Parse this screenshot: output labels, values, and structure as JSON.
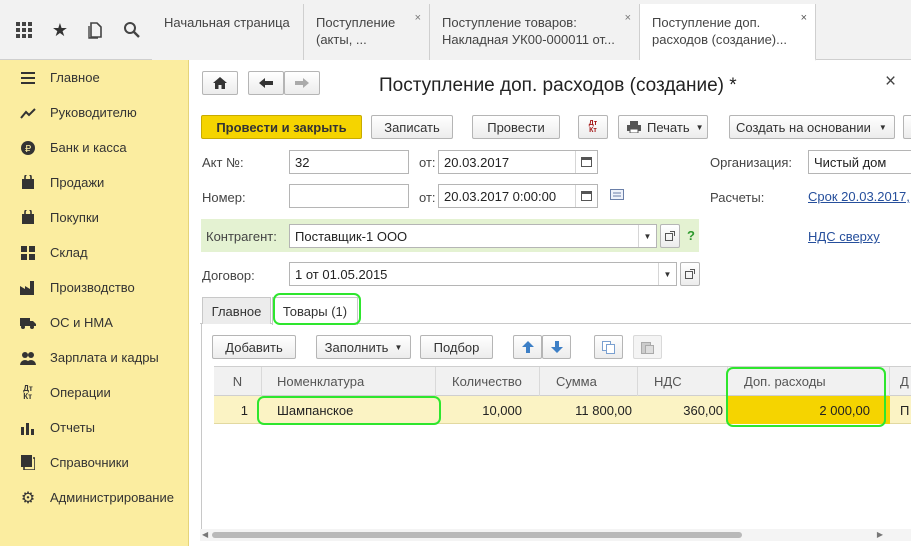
{
  "topbar": {
    "icons": [
      "apps-grid-icon",
      "star-icon",
      "history-icon",
      "search-icon"
    ],
    "tabs": [
      {
        "label": "Начальная страница"
      },
      {
        "label": "Поступление (акты, ..."
      },
      {
        "label": "Поступление товаров: Накладная УК00-000011 от..."
      },
      {
        "label": "Поступление доп. расходов (создание)..."
      }
    ],
    "close_glyph": "×"
  },
  "sidebar": {
    "items": [
      {
        "label": "Главное",
        "icon": "menu-icon"
      },
      {
        "label": "Руководителю",
        "icon": "trend-icon"
      },
      {
        "label": "Банк и касса",
        "icon": "ruble-icon"
      },
      {
        "label": "Продажи",
        "icon": "bag-icon"
      },
      {
        "label": "Покупки",
        "icon": "cart-icon"
      },
      {
        "label": "Склад",
        "icon": "warehouse-icon"
      },
      {
        "label": "Производство",
        "icon": "factory-icon"
      },
      {
        "label": "ОС и НМА",
        "icon": "truck-icon"
      },
      {
        "label": "Зарплата и кадры",
        "icon": "people-icon"
      },
      {
        "label": "Операции",
        "icon": "dt-kt-icon"
      },
      {
        "label": "Отчеты",
        "icon": "bar-chart-icon"
      },
      {
        "label": "Справочники",
        "icon": "book-icon"
      },
      {
        "label": "Администрирование",
        "icon": "gear-icon"
      }
    ]
  },
  "header": {
    "title": "Поступление доп. расходов (создание) *",
    "close": "×"
  },
  "toolbar": {
    "post_close": "Провести и закрыть",
    "save": "Записать",
    "post": "Провести",
    "dtkt": "Дт Кт",
    "print": "Печать",
    "create_based": "Создать на основании"
  },
  "form": {
    "act_label": "Акт №:",
    "act_value": "32",
    "from_label": "от:",
    "act_date": "20.03.2017",
    "number_label": "Номер:",
    "number_value": "",
    "number_date": "20.03.2017  0:00:00",
    "org_label": "Организация:",
    "org_value": "Чистый дом",
    "calc_label": "Расчеты:",
    "calc_link": "Срок 20.03.2017,",
    "vat_link": "НДС сверху",
    "counterparty_label": "Контрагент:",
    "counterparty_value": "Поставщик-1 ООО",
    "help": "?",
    "contract_label": "Договор:",
    "contract_value": "1 от 01.05.2015"
  },
  "tabs": [
    {
      "label": "Главное"
    },
    {
      "label": "Товары (1)"
    }
  ],
  "table_toolbar": {
    "add": "Добавить",
    "fill": "Заполнить",
    "select": "Подбор"
  },
  "table": {
    "columns": [
      "N",
      "Номенклатура",
      "Количество",
      "Сумма",
      "НДС",
      "Доп. расходы",
      "Д"
    ],
    "rows": [
      {
        "n": "1",
        "item": "Шампанское",
        "qty": "10,000",
        "sum": "11 800,00",
        "vat": "360,00",
        "extra": "2 000,00",
        "d": "П"
      }
    ]
  },
  "colors": {
    "accent": "#f5d400",
    "sidebar_bg": "#fbeda0",
    "highlight": "#2ee62e",
    "link": "#264f9c"
  }
}
